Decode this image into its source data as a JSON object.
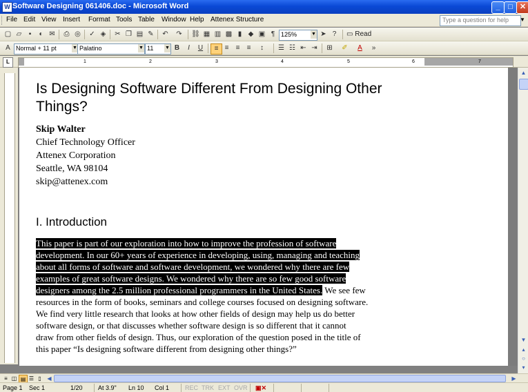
{
  "window": {
    "title": "Software Designing 061406.doc - Microsoft Word"
  },
  "menu": [
    "File",
    "Edit",
    "View",
    "Insert",
    "Format",
    "Tools",
    "Table",
    "Window",
    "Help",
    "Attenex Structure"
  ],
  "ask_placeholder": "Type a question for help",
  "toolbar": {
    "zoom": "125%",
    "read_label": "Read"
  },
  "formatting": {
    "style": "Normal + 11 pt",
    "font": "Palatino",
    "size": "11"
  },
  "ruler_numbers": [
    "1",
    "2",
    "3",
    "4",
    "5",
    "6",
    "7"
  ],
  "document": {
    "title_line1": "Is Designing Software Different From Designing Other",
    "title_line2": "Things?",
    "author": {
      "name": "Skip Walter",
      "role": "Chief Technology Officer",
      "company": "Attenex Corporation",
      "location": "Seattle, WA 98104",
      "email": "skip@attenex.com"
    },
    "section_heading": "I.  Introduction",
    "paragraph_lines": [
      {
        "sel": "This paper is part of our exploration into how to improve the profession of software",
        "rest": ""
      },
      {
        "sel": "development.  In our 60+ years of experience in developing, using, managing and teaching",
        "rest": ""
      },
      {
        "sel": "about all forms of software and software development, we wondered why there are few",
        "rest": ""
      },
      {
        "sel": "examples of great software designs.  We wondered why there are so few good software",
        "rest": ""
      },
      {
        "sel": "designers among the 2.5 million professional programmers in the United States.",
        "rest": "  We see few"
      },
      {
        "sel": "",
        "rest": "resources in the form of books, seminars and college courses focused on designing software."
      },
      {
        "sel": "",
        "rest": "We find very little research that looks at how other fields of design may help us do better"
      },
      {
        "sel": "",
        "rest": "software design, or that discusses whether software design is so different that it cannot"
      },
      {
        "sel": "",
        "rest": "draw from other fields of design.  Thus, our exploration of the question posed in the title of"
      },
      {
        "sel": "",
        "rest": "this paper “Is designing software different from designing other things?”"
      }
    ]
  },
  "status": {
    "page": "Page  1",
    "sec": "Sec  1",
    "pages": "1/20",
    "at": "At  3.9\"",
    "ln": "Ln  10",
    "col": "Col  1",
    "modes": [
      "REC",
      "TRK",
      "EXT",
      "OVR"
    ]
  }
}
